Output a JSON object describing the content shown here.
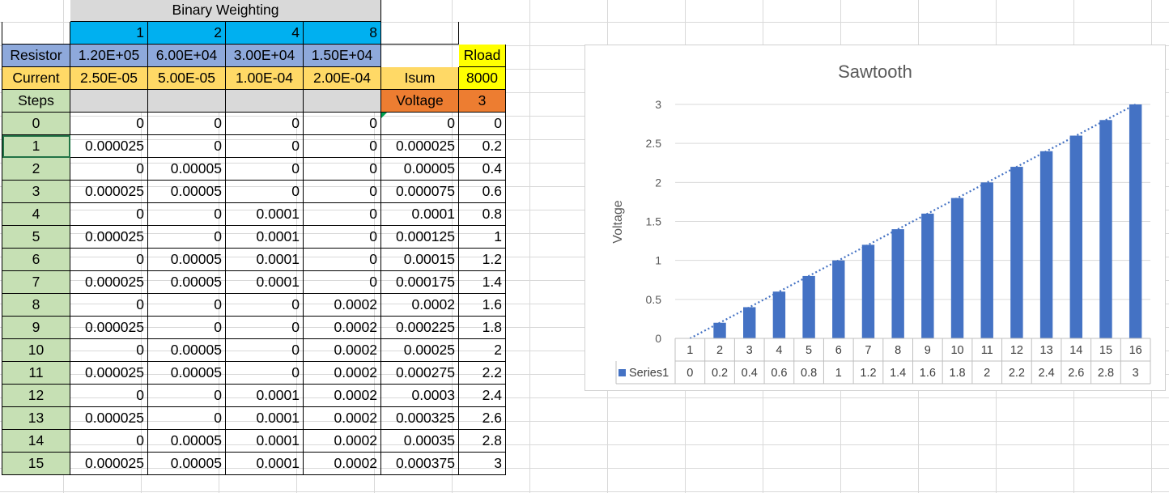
{
  "header": {
    "title": "Binary Weighting",
    "weights": [
      "1",
      "2",
      "4",
      "8"
    ]
  },
  "resistor_row": {
    "label": "Resistor",
    "values": [
      "1.20E+05",
      "6.00E+04",
      "3.00E+04",
      "1.50E+04"
    ],
    "rload_label": "Rload"
  },
  "current_row": {
    "label": "Current",
    "values": [
      "2.50E-05",
      "5.00E-05",
      "1.00E-04",
      "2.00E-04"
    ],
    "isum_label": "Isum",
    "rload_value": "8000"
  },
  "steps_row": {
    "label": "Steps",
    "voltage_label": "Voltage",
    "voltage_value": "3"
  },
  "rows": [
    [
      "0",
      "0",
      "0",
      "0",
      "0",
      "0",
      "0"
    ],
    [
      "1",
      "0.000025",
      "0",
      "0",
      "0",
      "0.000025",
      "0.2"
    ],
    [
      "2",
      "0",
      "0.00005",
      "0",
      "0",
      "0.00005",
      "0.4"
    ],
    [
      "3",
      "0.000025",
      "0.00005",
      "0",
      "0",
      "0.000075",
      "0.6"
    ],
    [
      "4",
      "0",
      "0",
      "0.0001",
      "0",
      "0.0001",
      "0.8"
    ],
    [
      "5",
      "0.000025",
      "0",
      "0.0001",
      "0",
      "0.000125",
      "1"
    ],
    [
      "6",
      "0",
      "0.00005",
      "0.0001",
      "0",
      "0.00015",
      "1.2"
    ],
    [
      "7",
      "0.000025",
      "0.00005",
      "0.0001",
      "0",
      "0.000175",
      "1.4"
    ],
    [
      "8",
      "0",
      "0",
      "0",
      "0.0002",
      "0.0002",
      "1.6"
    ],
    [
      "9",
      "0.000025",
      "0",
      "0",
      "0.0002",
      "0.000225",
      "1.8"
    ],
    [
      "10",
      "0",
      "0.00005",
      "0",
      "0.0002",
      "0.00025",
      "2"
    ],
    [
      "11",
      "0.000025",
      "0.00005",
      "0",
      "0.0002",
      "0.000275",
      "2.2"
    ],
    [
      "12",
      "0",
      "0",
      "0.0001",
      "0.0002",
      "0.0003",
      "2.4"
    ],
    [
      "13",
      "0.000025",
      "0",
      "0.0001",
      "0.0002",
      "0.000325",
      "2.6"
    ],
    [
      "14",
      "0",
      "0.00005",
      "0.0001",
      "0.0002",
      "0.00035",
      "2.8"
    ],
    [
      "15",
      "0.000025",
      "0.00005",
      "0.0001",
      "0.0002",
      "0.000375",
      "3"
    ]
  ],
  "chart_data": {
    "type": "bar",
    "title": "Sawtooth",
    "ylabel": "Voltage",
    "categories": [
      "1",
      "2",
      "3",
      "4",
      "5",
      "6",
      "7",
      "8",
      "9",
      "10",
      "11",
      "12",
      "13",
      "14",
      "15",
      "16"
    ],
    "series": [
      {
        "name": "Series1",
        "values": [
          0,
          0.2,
          0.4,
          0.6,
          0.8,
          1,
          1.2,
          1.4,
          1.6,
          1.8,
          2,
          2.2,
          2.4,
          2.6,
          2.8,
          3
        ]
      }
    ],
    "yticks": [
      "0",
      "0.5",
      "1",
      "1.5",
      "2",
      "2.5",
      "3"
    ],
    "ylim": [
      0,
      3
    ],
    "trendline": "linear",
    "data_table": true,
    "bar_color": "#4472c4",
    "trend_color": "#4472c4",
    "grid": true
  }
}
